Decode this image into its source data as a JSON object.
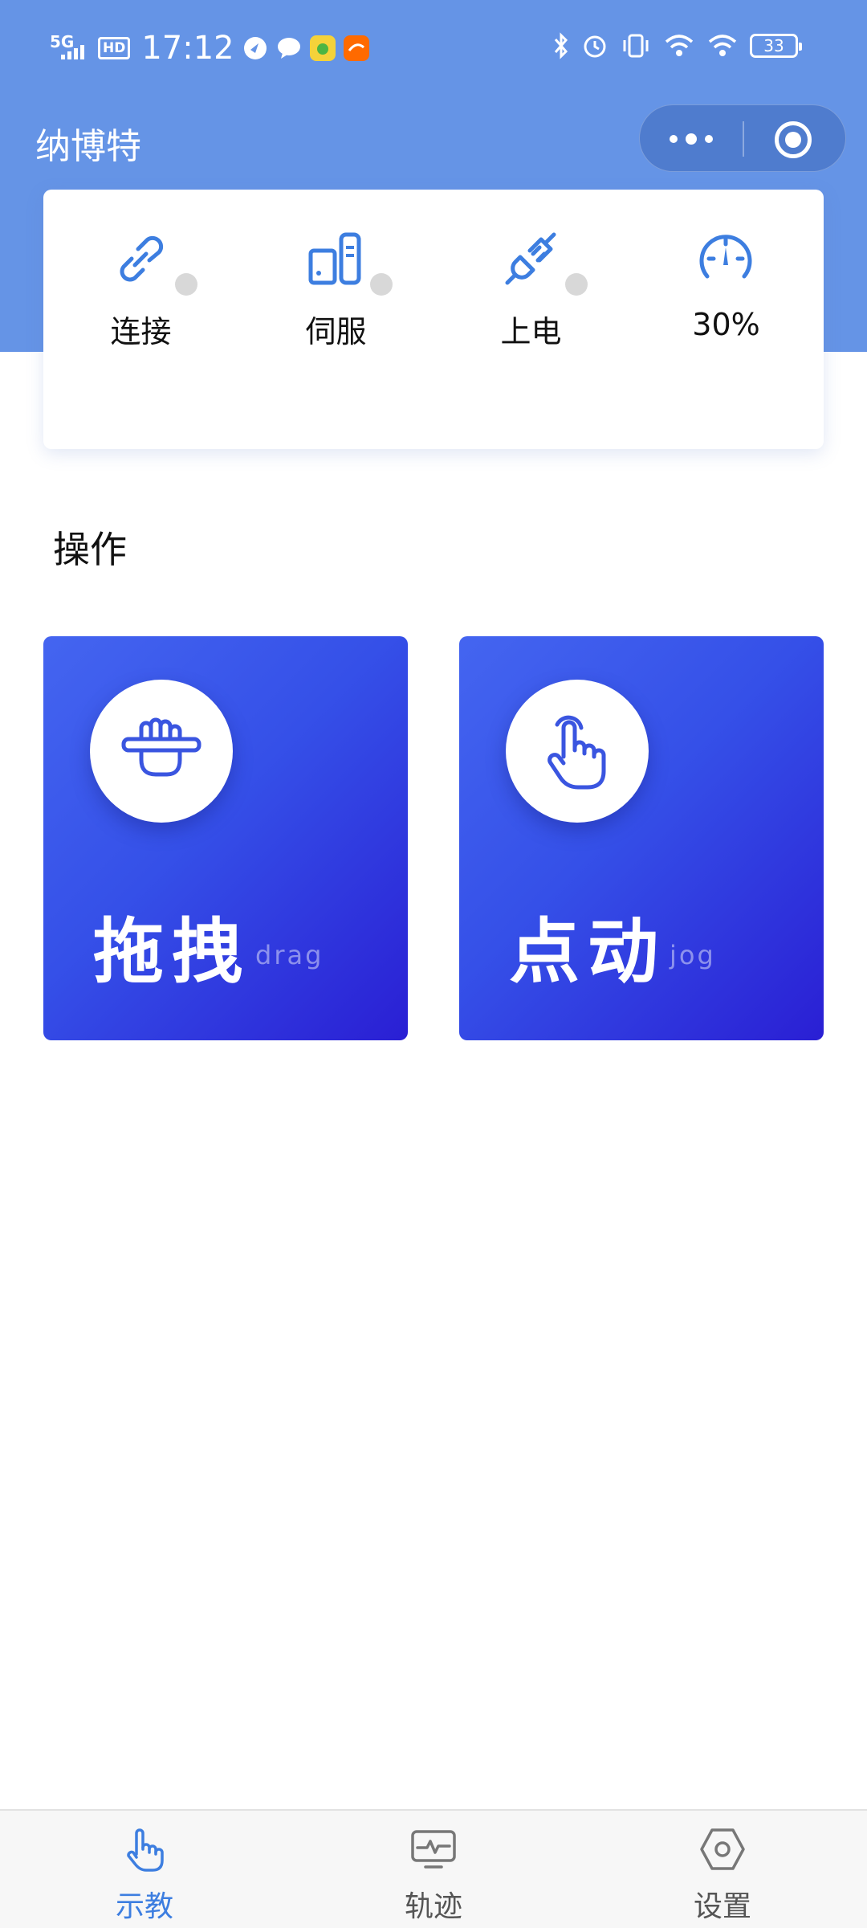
{
  "status_bar": {
    "network": "5G",
    "hd": "HD",
    "time": "17:12",
    "battery": "33"
  },
  "header": {
    "title": "纳博特"
  },
  "status": {
    "items": [
      {
        "label": "连接",
        "icon": "link-icon"
      },
      {
        "label": "伺服",
        "icon": "servo-icon"
      },
      {
        "label": "上电",
        "icon": "power-plug-icon"
      },
      {
        "label": "30%",
        "icon": "speedometer-icon"
      }
    ]
  },
  "section": {
    "title": "操作"
  },
  "operations": [
    {
      "label": "拖拽",
      "sublabel": "drag",
      "icon": "grab-hand-icon"
    },
    {
      "label": "点动",
      "sublabel": "jog",
      "icon": "tap-hand-icon"
    }
  ],
  "tabbar": {
    "tabs": [
      {
        "label": "示教",
        "icon": "hand-pointer-icon",
        "active": true
      },
      {
        "label": "轨迹",
        "icon": "trajectory-monitor-icon",
        "active": false
      },
      {
        "label": "设置",
        "icon": "hex-nut-settings-icon",
        "active": false
      }
    ]
  },
  "colors": {
    "header_bg": "#6594e6",
    "accent": "#3d7ee0",
    "card_gradient_start": "#4465f0",
    "card_gradient_end": "#2a1fd4",
    "indicator_off": "#d8d8d8"
  }
}
